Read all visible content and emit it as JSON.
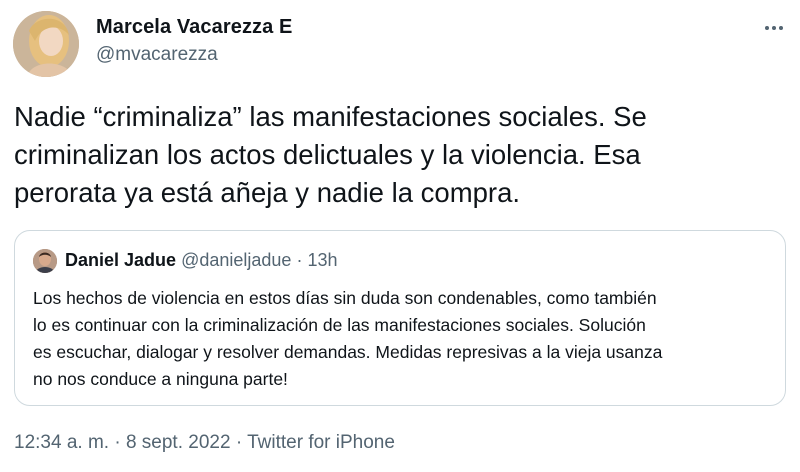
{
  "author": {
    "display_name": "Marcela Vacarezza E",
    "handle": "@mvacarezza"
  },
  "tweet": {
    "lines": [
      "Nadie “criminaliza” las manifestaciones sociales. Se",
      "criminalizan los actos delictuales y la violencia. Esa",
      "perorata ya está añeja y nadie la compra."
    ]
  },
  "quote": {
    "name": "Daniel Jadue",
    "handle": "@danieljadue",
    "separator": "·",
    "time": "13h",
    "lines": [
      "Los hechos de violencia en estos días sin duda son condenables, como también",
      "lo es continuar con la criminalización de las manifestaciones sociales. Solución",
      "es escuchar, dialogar y resolver demandas. Medidas represivas a la vieja usanza",
      "no nos conduce a ninguna parte!"
    ]
  },
  "footer": {
    "time": "12:34 a. m.",
    "separator": "·",
    "date": "8 sept. 2022",
    "source": "Twitter for iPhone"
  },
  "icons": {
    "more": "more-horizontal-icon"
  },
  "colors": {
    "text": "#0f1419",
    "secondary": "#536471",
    "border": "#cfd9de"
  }
}
